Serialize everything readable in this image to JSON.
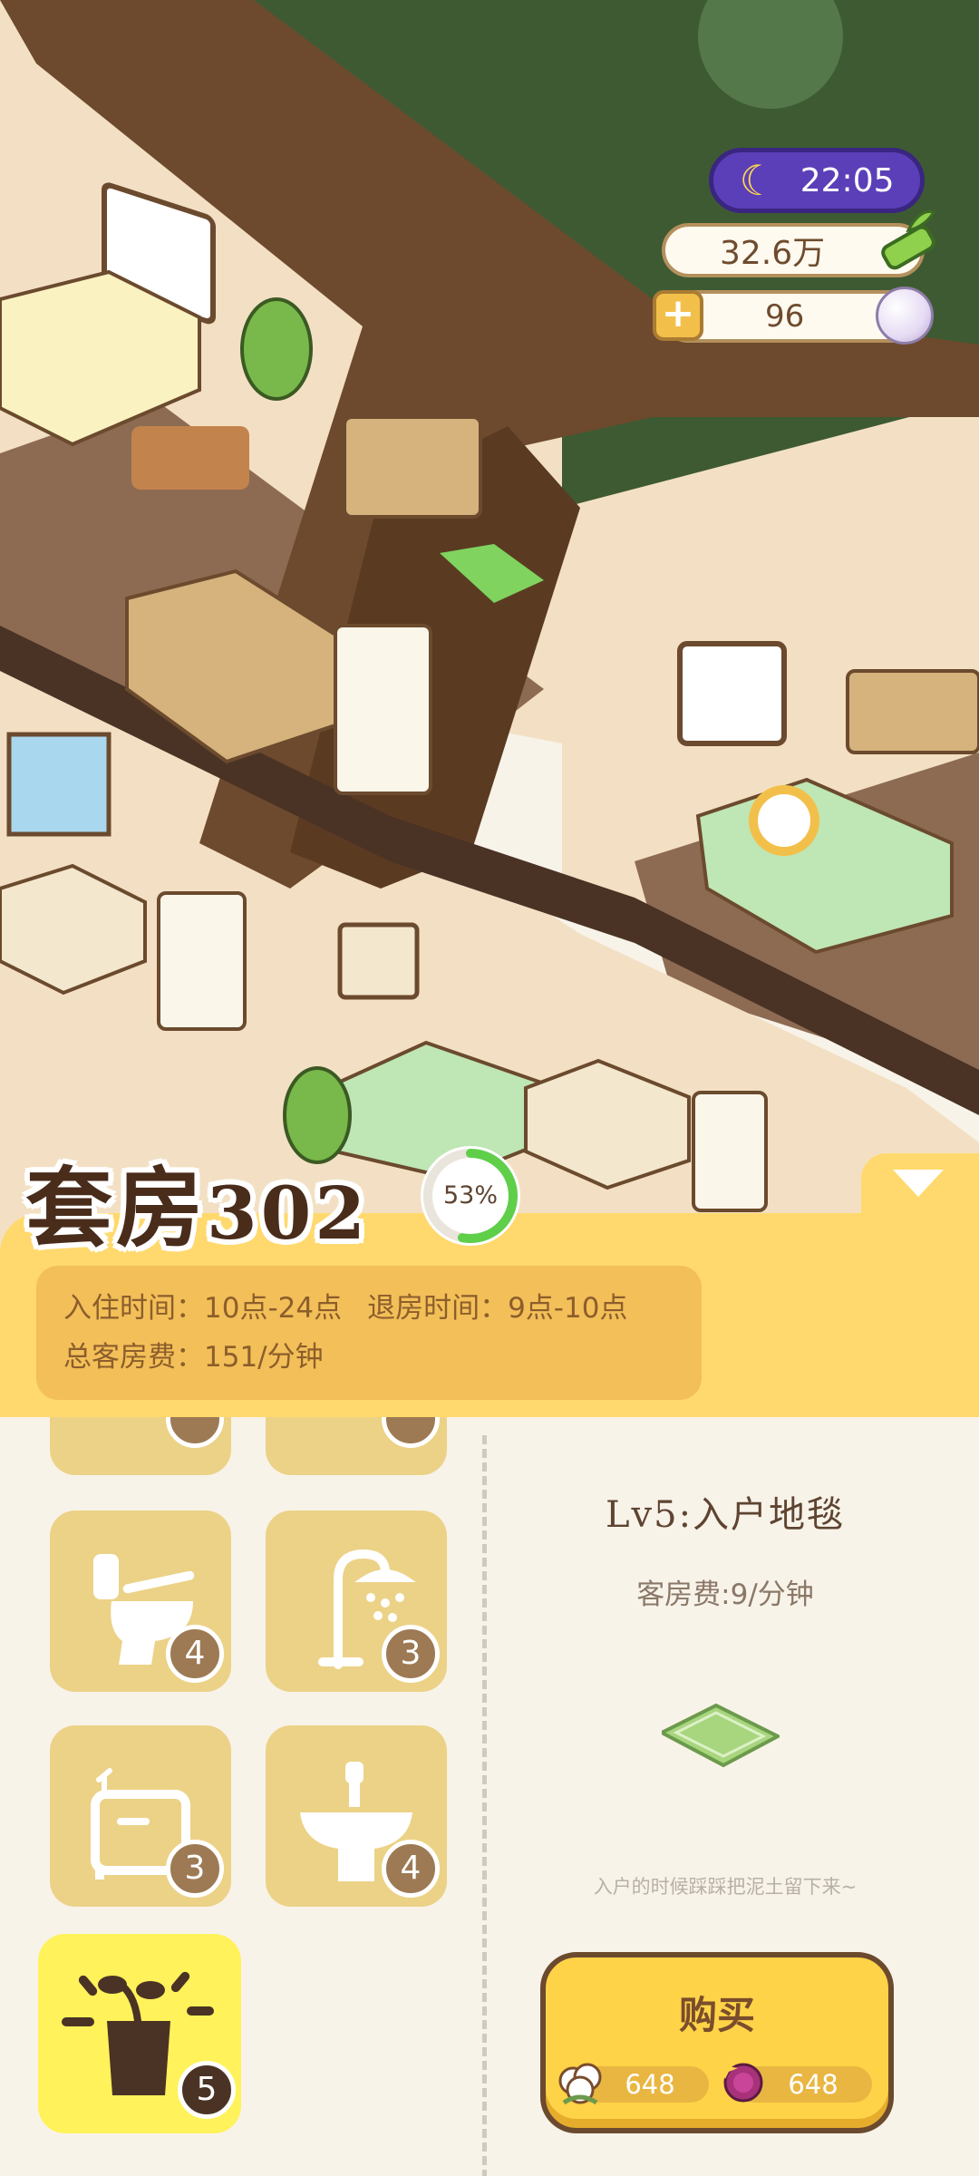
{
  "hud": {
    "time": "22:05",
    "money": "32.6万",
    "pearls": "96"
  },
  "room": {
    "name": "套房",
    "number": "302",
    "progress_percent": 53,
    "progress_label": "53%",
    "checkin": "入住时间：10点-24点",
    "checkout": "退房时间：9点-10点",
    "total_fee": "总客房费：151/分钟"
  },
  "furniture_tiles": [
    {
      "icon": "toilet-icon",
      "count": "4"
    },
    {
      "icon": "shower-icon",
      "count": "3"
    },
    {
      "icon": "cabinet-icon",
      "count": "3"
    },
    {
      "icon": "sink-icon",
      "count": "4"
    },
    {
      "icon": "sprout-pot-icon",
      "count": "5",
      "selected": true
    }
  ],
  "partial_tiles": [
    {
      "icon": "partial-item-icon"
    },
    {
      "icon": "partial-item-icon"
    }
  ],
  "item": {
    "name": "Lv5:入户地毯",
    "fee": "客房费:9/分钟",
    "description": "入户的时候踩踩把泥土留下来~",
    "buy_label": "购买",
    "cotton_price": "648",
    "flower_price": "648"
  },
  "colors": {
    "panel": "#ffd96d",
    "info_box": "#f3bf58",
    "tile": "#ecd287",
    "tile_selected": "#fff25a",
    "hud_time_bg": "#5b3fb8",
    "progress": "#5fcf4a"
  }
}
